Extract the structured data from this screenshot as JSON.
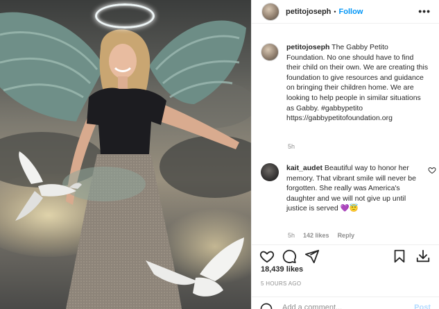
{
  "post": {
    "username": "petitojoseph",
    "dot": "•",
    "follow_label": "Follow",
    "more_label": "•••"
  },
  "caption": {
    "username": "petitojoseph",
    "text": " The Gabby Petito Foundation. No one should have to find their child on their own. We are creating this foundation to give resources and guidance on bringing their children home. We are looking to help people in similar situations as Gabby. ",
    "hashtag": "#gabbypetito",
    "link": "https://gabbypetitofoundation.org",
    "time": "5h"
  },
  "comment": {
    "username": "kait_audet",
    "text": " Beautiful way to honor her memory. That vibrant smile will never be forgotten. She really was America's daughter and we will not give up until justice is served",
    "emojis": "💜😇",
    "time": "5h",
    "likes": "142 likes",
    "reply": "Reply"
  },
  "stats": {
    "likes": "18,439 likes",
    "date": "5 HOURS AGO"
  },
  "add_comment": {
    "placeholder": "Add a comment...",
    "post_label": "Post"
  },
  "icons": {
    "heart": "heart-icon",
    "comment": "comment-icon",
    "share": "share-icon",
    "save": "bookmark-icon",
    "download": "download-icon",
    "emoji": "emoji-icon"
  },
  "colors": {
    "link_blue": "#0095f6",
    "text": "#262626",
    "muted": "#8e8e8e"
  }
}
